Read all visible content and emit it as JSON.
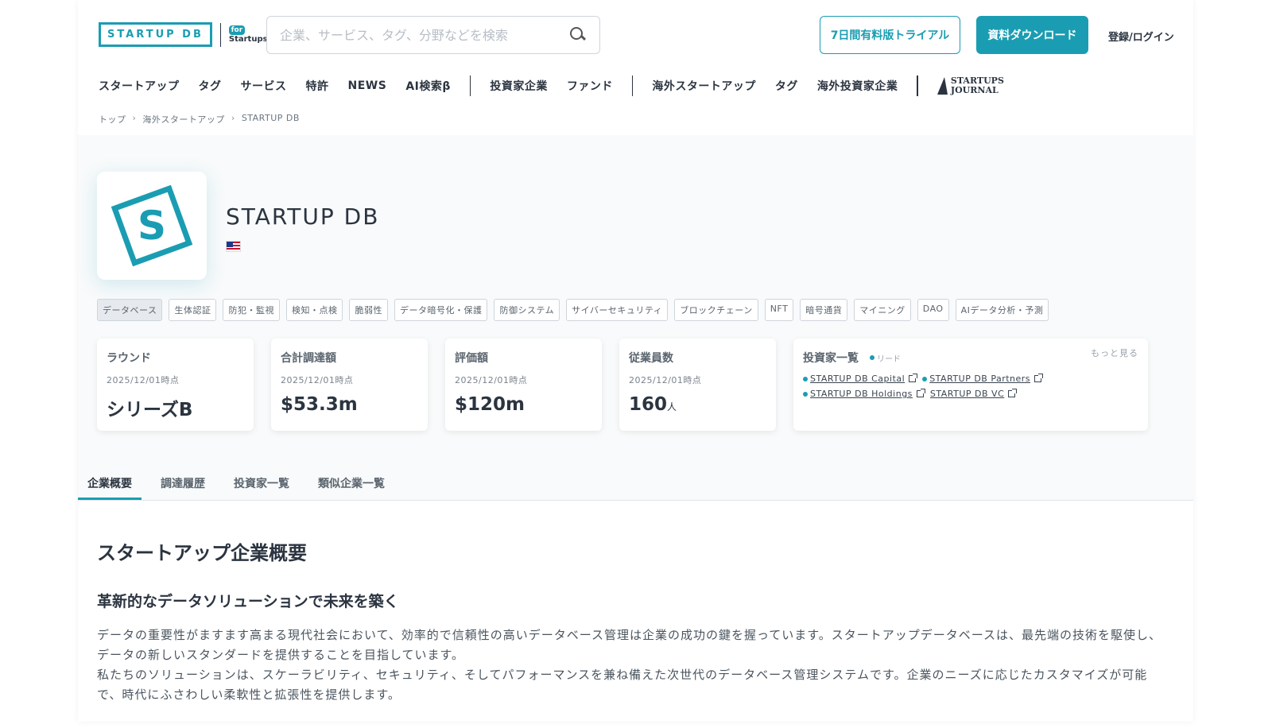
{
  "header": {
    "logo_text": "STARTUP DB",
    "for_badge": "for",
    "for_text": "Startups",
    "search_placeholder": "企業、サービス、タグ、分野などを検索",
    "trial_button": "7日間有料版トライアル",
    "download_button": "資料ダウンロード",
    "login_link": "登録/ログイン"
  },
  "nav": {
    "group1": [
      "スタートアップ",
      "タグ",
      "サービス",
      "特許",
      "NEWS",
      "AI検索β"
    ],
    "group2": [
      "投資家企業",
      "ファンド"
    ],
    "group3": [
      "海外スタートアップ",
      "タグ",
      "海外投資家企業"
    ],
    "journal_line1": "STARTUPS",
    "journal_line2": "JOURNAL"
  },
  "breadcrumb": [
    "トップ",
    "海外スタートアップ",
    "STARTUP DB"
  ],
  "company": {
    "logo_letter": "S",
    "name": "STARTUP DB",
    "country_flag": "us-flag"
  },
  "tags": [
    "データベース",
    "生体認証",
    "防犯・監視",
    "検知・点検",
    "脆弱性",
    "データ暗号化・保護",
    "防御システム",
    "サイバーセキュリティ",
    "ブロックチェーン",
    "NFT",
    "暗号通貨",
    "マイニング",
    "DAO",
    "AIデータ分析・予測"
  ],
  "stats": [
    {
      "title": "ラウンド",
      "date": "2025/12/01時点",
      "value": "シリーズB",
      "unit": ""
    },
    {
      "title": "合計調達額",
      "date": "2025/12/01時点",
      "value": "$53.3m",
      "unit": ""
    },
    {
      "title": "評価額",
      "date": "2025/12/01時点",
      "value": "$120m",
      "unit": ""
    },
    {
      "title": "従業員数",
      "date": "2025/12/01時点",
      "value": "160",
      "unit": "人"
    }
  ],
  "investors": {
    "title": "投資家一覧",
    "lead_label": "リード",
    "more_label": "もっと見る",
    "list": [
      {
        "name": "STARTUP DB Capital",
        "lead": true
      },
      {
        "name": "STARTUP DB Partners",
        "lead": true
      },
      {
        "name": "STARTUP DB Holdings",
        "lead": true
      },
      {
        "name": "STARTUP DB VC",
        "lead": false
      }
    ]
  },
  "tabs": [
    "企業概要",
    "調達履歴",
    "投資家一覧",
    "類似企業一覧"
  ],
  "overview": {
    "title": "スタートアップ企業概要",
    "subtitle": "革新的なデータソリューションで未来を築く",
    "paragraph1": "データの重要性がますます高まる現代社会において、効率的で信頼性の高いデータベース管理は企業の成功の鍵を握っています。スタートアップデータベースは、最先端の技術を駆使し、データの新しいスタンダードを提供することを目指しています。",
    "paragraph2": "私たちのソリューションは、スケーラビリティ、セキュリティ、そしてパフォーマンスを兼ね備えた次世代のデータベース管理システムです。企業のニーズに応じたカスタマイズが可能で、時代にふさわしい柔軟性と拡張性を提供します。"
  },
  "colors": {
    "accent": "#1a9db2",
    "text": "#2b3440"
  }
}
